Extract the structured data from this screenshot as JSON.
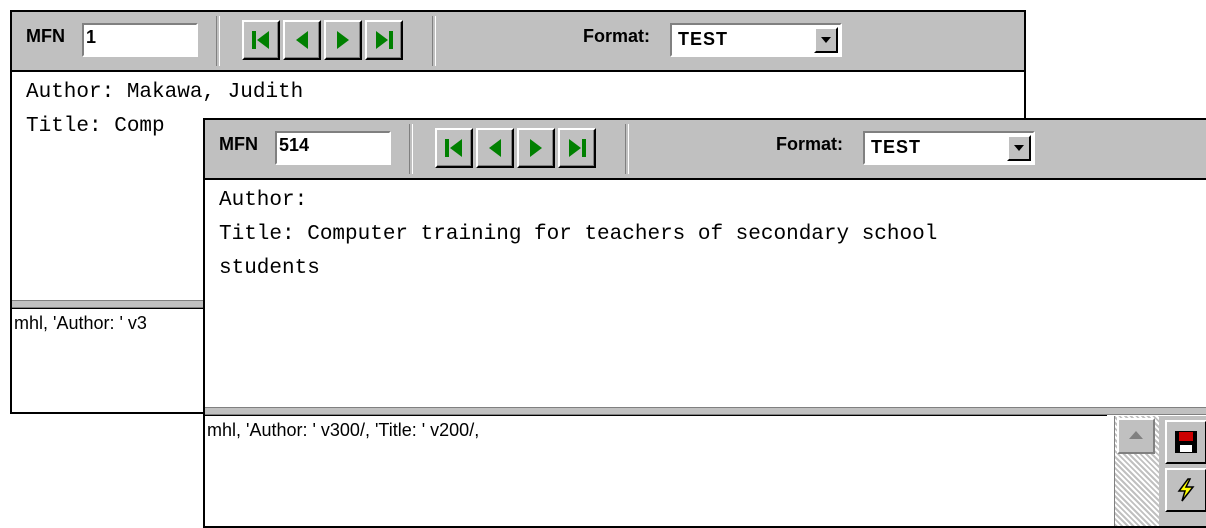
{
  "back_window": {
    "mfn_label": "MFN",
    "mfn_value": "1",
    "format_label": "Format:",
    "format_value": "TEST",
    "display_lines": [
      "Author: Makawa, Judith",
      "Title: Comp"
    ],
    "format_text": "mhl, 'Author: ' v3"
  },
  "front_window": {
    "mfn_label": "MFN",
    "mfn_value": "514",
    "format_label": "Format:",
    "format_value": "TEST",
    "display_lines": [
      "Author:",
      "Title: Computer training for teachers of secondary school",
      "students"
    ],
    "format_text": "mhl, 'Author: ' v300/, 'Title: ' v200/,"
  },
  "icons": {
    "first": "first-record-icon",
    "prev": "previous-record-icon",
    "next": "next-record-icon",
    "last": "last-record-icon",
    "dropdown": "chevron-down-icon",
    "scroll_up": "scroll-up-arrow-icon",
    "save": "floppy-disk-icon",
    "run": "lightning-bolt-icon"
  },
  "colors": {
    "chrome": "#c0c0c0",
    "nav_arrow": "#008000",
    "save_red": "#cc0000",
    "bolt_yellow": "#ffff00"
  }
}
